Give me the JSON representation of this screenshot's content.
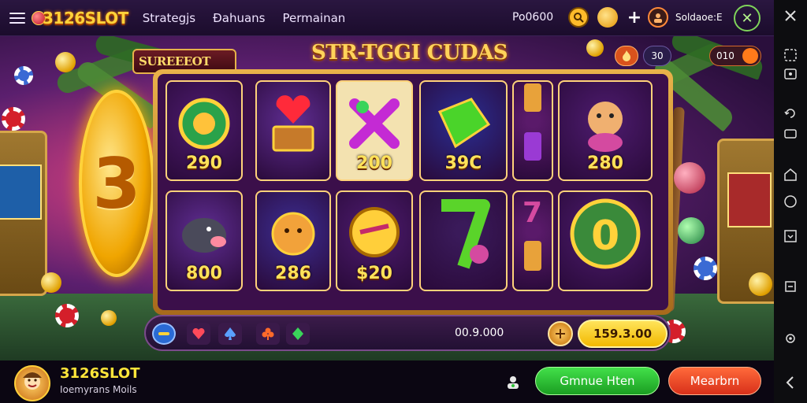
{
  "header": {
    "logo_text": "3126SLOT",
    "nav": [
      "Strategjs",
      "Ðahuans",
      "Permainan"
    ],
    "balance": "Po0600",
    "username": "Soldaoe:E"
  },
  "game": {
    "title": "STR-TGGI CUDAS",
    "left_badge": "SUREEEOT",
    "big_coin_glyph": "3",
    "pill_a": "",
    "pill_b": "30",
    "pill_c": "010",
    "tiles": [
      {
        "value": "290",
        "icon": "wheel-coin-icon",
        "bg": "#4a1a6a"
      },
      {
        "value": "",
        "icon": "heart-chest-icon",
        "bg": "#5a2a8a"
      },
      {
        "value": "200",
        "icon": "x-leaf-icon",
        "bg": "#f3e2b0"
      },
      {
        "value": "39C",
        "icon": "green-gem-icon",
        "bg": "#2a2a8a"
      },
      {
        "value": "",
        "icon": "lantern-icon",
        "bg": "#5a1a6a"
      },
      {
        "value": "280",
        "icon": "dog-mascot-icon",
        "bg": "#4a1a6a"
      },
      {
        "value": "800",
        "icon": "boar-icon",
        "bg": "#5a2a8a"
      },
      {
        "value": "286",
        "icon": "golden-cat-icon",
        "bg": "#3a2a8a"
      },
      {
        "value": "$20",
        "icon": "gold-coin-icon",
        "bg": "#4a1a6a"
      },
      {
        "value": "",
        "icon": "lucky-seven-icon",
        "bg": "#3a1a5a"
      },
      {
        "value": "",
        "icon": "seven-jar-icon",
        "bg": "#5a1a6a"
      },
      {
        "value": "",
        "icon": "jackpot-zero-icon",
        "bg": "#4a1a6a"
      }
    ]
  },
  "controls": {
    "bet": "00.9.000",
    "win": "159.3.00"
  },
  "footer": {
    "brand": "3126SLOT",
    "subtitle": "Ioemyrans Moils",
    "green_button": "Gmnue Hten",
    "red_button": "Mearbrn"
  },
  "colors": {
    "accent_gold": "#ffd23a",
    "green": "#2fc437",
    "red": "#e8431f",
    "panel": "#3b0f4a"
  }
}
